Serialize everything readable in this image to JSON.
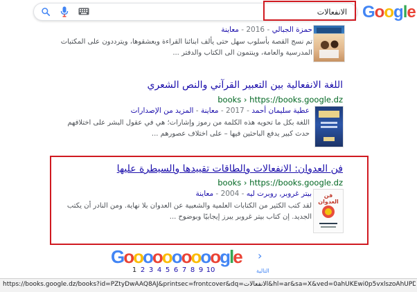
{
  "search": {
    "query": "الانفعالات"
  },
  "logo": {
    "letters": [
      "G",
      "o",
      "o",
      "g",
      "l",
      "e"
    ]
  },
  "results": [
    {
      "meta_author": "حمزة الجبالي",
      "meta_year": "2016",
      "meta_preview": "معاينة",
      "snippet_1": "تم نسج القصة بأسلوب سهل حتى يألف ابنائنا القراءة ويعشقوها، ويترددون على المكتبات",
      "snippet_2": "المدرسية والعامة، وينتمون الى الكتاب والدفتر ..."
    },
    {
      "title": "اللغة الانفعالية بين التعبير القرآني والنص الشعري",
      "url": "books › https://books.google.dz",
      "meta_author": "عطية سليمان أحمد",
      "meta_year": "2017",
      "meta_preview": "معاينة",
      "meta_more": "المزيد من الإصدارات",
      "snippet_1": "اللغة بكل ما تحويه هذه الكلمة من رموز وإشارات؛ هي في عقول البشر على اختلافهم",
      "snippet_2": "حدث كبير يدفع الباحثين فيها – على اختلاف عصورهم ..."
    },
    {
      "title": "فن العدوان: الانفعالات والطاقات تقييدها والسيطرة عليها",
      "url": "books › https://books.google.dz",
      "meta_author": "بيتر غروبر, روبرت ليه",
      "meta_year": "2004",
      "meta_preview": "معاينة",
      "snippet_1": "لقد كتب الكثير من الكتابات العلمية والشعبية عن العدوان بلا نهاية. ومن النادر أن يكتب",
      "snippet_2": "الجديد. إن كتاب بيتر غروبر يبرز إيجابيًا وبوضوح ...",
      "cover_title": "فن العدوان"
    }
  ],
  "pagination": {
    "logo_text": "Gooooooooooogle",
    "pages": [
      "1",
      "2",
      "3",
      "4",
      "5",
      "6",
      "7",
      "8",
      "9",
      "10"
    ],
    "current": "1",
    "next_label": "التالية",
    "next_arrow": "›"
  },
  "status_url": "https://books.google.dz/books?id=PZtyDwAAQ8AJ&printsec=frontcover&dq=الانفعالات&hl=ar&sa=X&ved=0ahUKEwi0p5vxlszoAhUPDmMBHcaEDbcQ6AEI",
  "colors": {
    "link": "#1a0dab",
    "url_green": "#006621",
    "highlight_red": "#d01920",
    "mic_blue": "#4285F4",
    "mic_red": "#EA4335"
  },
  "icons": [
    "search-icon",
    "mic-icon",
    "keyboard-icon",
    "chevron-right-icon"
  ]
}
